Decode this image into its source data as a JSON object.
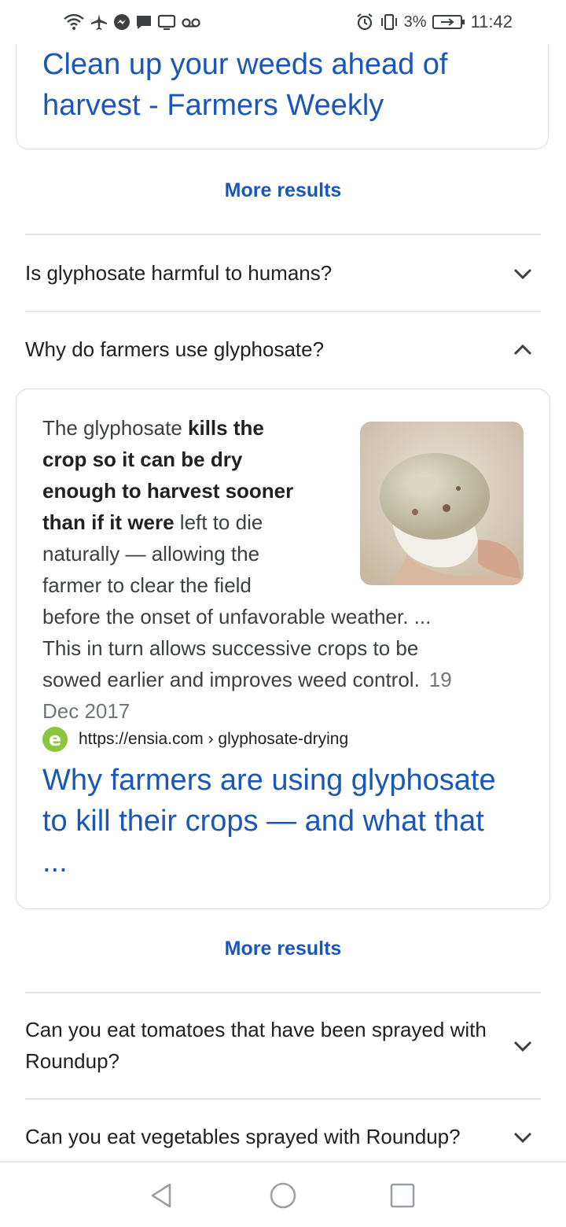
{
  "status_bar": {
    "battery_percent": "3%",
    "time": "11:42",
    "left_icons": [
      "wifi-icon",
      "airplane-icon",
      "messenger-icon",
      "chat-icon",
      "screen-icon",
      "voicemail-icon"
    ],
    "right_icons": [
      "alarm-icon",
      "vibrate-icon",
      "battery-icon"
    ]
  },
  "top_result": {
    "title": "Clean up your weeds ahead of harvest - Farmers Weekly"
  },
  "more_results_label": "More results",
  "faq": [
    {
      "question": "Is glyphosate harmful to humans?",
      "expanded": false
    },
    {
      "question": "Why do farmers use glyphosate?",
      "expanded": true
    },
    {
      "question": "Can you eat tomatoes that have been sprayed with Roundup?",
      "expanded": false
    },
    {
      "question": "Can you eat vegetables sprayed with Roundup?",
      "expanded": false
    }
  ],
  "answer": {
    "text_intro": "The glyphosate ",
    "text_bold": "kills the crop so it can be dry enough to harvest sooner than if it were",
    "text_rest": " left to die naturally — allowing the farmer to clear the field before the onset of unfavorable weather. ... This in turn allows successive crops to be sowed earlier and improves weed control.",
    "date": "19 Dec 2017",
    "source_url": "https://ensia.com › glyphosate-drying",
    "favicon_letter": "e",
    "result_title": "Why farmers are using glyphosate to kill their crops — and what that ..."
  },
  "colors": {
    "link": "#1a57b8",
    "text": "#202124",
    "muted": "#70757a",
    "border": "#dadce0",
    "favicon_bg": "#8cc63f"
  }
}
